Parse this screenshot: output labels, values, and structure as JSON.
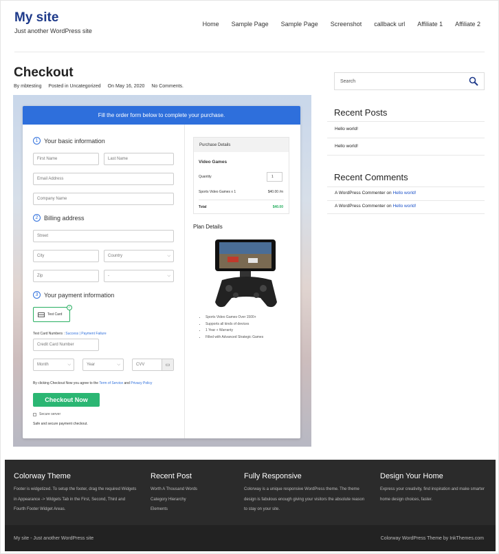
{
  "site": {
    "title": "My site",
    "tagline": "Just another WordPress site"
  },
  "nav": [
    "Home",
    "Sample Page",
    "Sample Page",
    "Screenshot",
    "callback url",
    "Affiliate 1",
    "Affiliate 2"
  ],
  "post": {
    "title": "Checkout",
    "author": "By mbtesting",
    "category": "Posted in Uncategorized",
    "date": "On May 16, 2020",
    "comments": "No Comments."
  },
  "form": {
    "banner": "Fill the order form below to complete your purchase.",
    "step1": {
      "num": "1",
      "label": "Your basic information"
    },
    "step2": {
      "num": "2",
      "label": "Billing address"
    },
    "step3": {
      "num": "3",
      "label": "Your payment information"
    },
    "first_name": "First Name",
    "last_name": "Last Name",
    "email": "Email Address",
    "company": "Company Name",
    "street": "Street",
    "city": "City",
    "country": "Country",
    "zip": "Zip",
    "state": "-",
    "test_card": "Test Card",
    "test_numbers_label": "Test Card Numbers :",
    "success_link": "Success",
    "separator": "|",
    "failure_link": "Payment Failure",
    "card_number": "Credit Card Number",
    "month": "Month",
    "year": "Year",
    "cvv": "CVV",
    "terms_prefix": "By clicking Checkout Now you agree to the",
    "terms_link": "Term of Service",
    "terms_and": "and",
    "privacy_link": "Privacy Policy",
    "checkout_button": "Checkout Now",
    "secure_server": "Secure server",
    "safe_text": "Safe and secure payment checkout."
  },
  "purchase": {
    "header": "Purchase Details",
    "product": "Video Games",
    "quantity_label": "Quantity",
    "quantity_value": "1",
    "line_item": "Sports Video Games x 1",
    "line_price": "$40.00 /m",
    "total_label": "Total",
    "total_value": "$40.00"
  },
  "plan": {
    "title": "Plan Details",
    "features": [
      "Sports Video Games Over 1500+",
      "Supports all kinds of devices",
      "1 Year + Warranty",
      "Filled with Advanced Strategic Games"
    ]
  },
  "sidebar": {
    "search_placeholder": "Search",
    "recent_posts_title": "Recent Posts",
    "recent_posts": [
      "Hello world!",
      "Hello world!"
    ],
    "recent_comments_title": "Recent Comments",
    "recent_comments": [
      {
        "author": "A WordPress Commenter",
        "on": "on",
        "post": "Hello world!"
      },
      {
        "author": "A WordPress Commenter",
        "on": "on",
        "post": "Hello world!"
      }
    ]
  },
  "footer": {
    "col1": {
      "title": "Colorway Theme",
      "text": "Footer is widgetized. To setup the footer, drag the required Widgets in Appearance -> Widgets Tab in the First, Second, Third and Fourth Footer Widget Areas."
    },
    "col2": {
      "title": "Recent Post",
      "items": [
        "Worth A Thousand Words",
        "Category Hierarchy",
        "Elements"
      ]
    },
    "col3": {
      "title": "Fully Responsive",
      "text": "Colorway is a unique responsive WordPress theme. The theme design is fabulous enough giving your visitors the absolute reason to stay on your site."
    },
    "col4": {
      "title": "Design Your Home",
      "text": "Express your creativity, find inspiration and make smarter home design choices, faster."
    },
    "bottom_left": "My site - Just another WordPress site",
    "bottom_right": "Colorway WordPress Theme by InkThemes.com"
  },
  "colors": {
    "brand": "#1e3a8a",
    "banner": "#2e6fdc",
    "button": "#2bb673",
    "footer": "#2b2b2b"
  }
}
